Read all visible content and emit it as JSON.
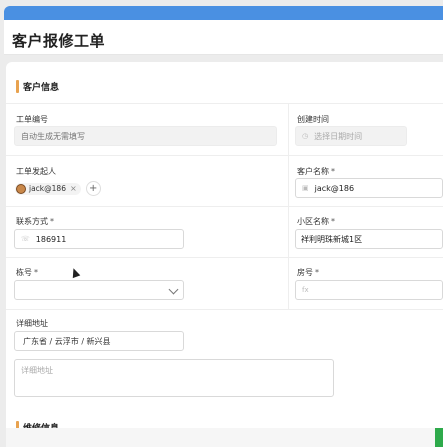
{
  "header": {
    "title": "客户报修工单"
  },
  "sections": {
    "customer_info": "客户信息",
    "next_section": "维修信息"
  },
  "fields": {
    "ticket_no": {
      "label": "工单编号",
      "value": "自动生成无需填写"
    },
    "created_at": {
      "label": "创建时间",
      "placeholder": "选择日期时间"
    },
    "initiator": {
      "label": "工单发起人",
      "tag": "jack@186"
    },
    "customer_name": {
      "label": "客户名称",
      "value": "jack@186"
    },
    "contact": {
      "label": "联系方式",
      "value": "186911"
    },
    "community": {
      "label": "小区名称",
      "value": "祥利明珠新城1区"
    },
    "building": {
      "label": "栋号",
      "value": ""
    },
    "room": {
      "label": "房号",
      "placeholder": ""
    },
    "address": {
      "label": "详细地址",
      "region": "广东省 / 云浮市 / 新兴县",
      "detail_placeholder": "详细地址"
    }
  },
  "colors": {
    "topbar": "#4a90e2",
    "section_accent": "#e8a24f",
    "green": "#2eaa4b"
  }
}
